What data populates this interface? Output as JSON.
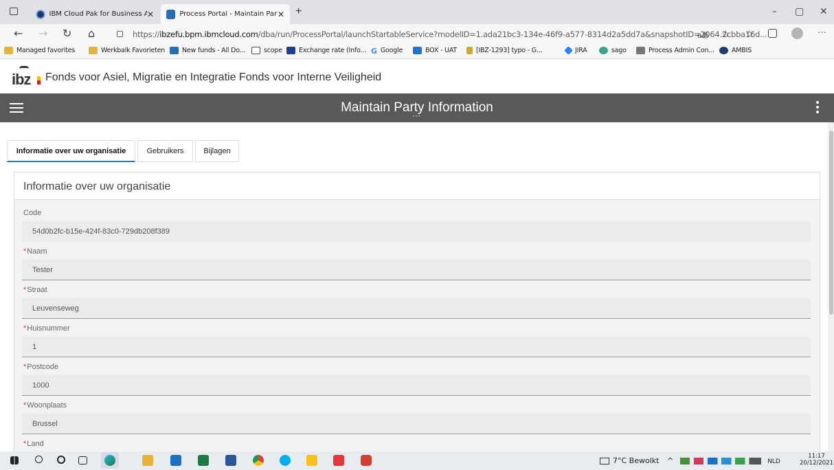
{
  "browser": {
    "tabs": [
      {
        "label": "IBM Cloud Pak for Business Auto",
        "active": false
      },
      {
        "label": "Process Portal - Maintain Party In",
        "active": true
      }
    ],
    "url_prefix": "https://",
    "url_host": "ibzefu.bpm.ibmcloud.com",
    "url_rest": "/dba/run/ProcessPortal/launchStartableService?modelID=1.ada21bc3-134e-46f9-a577-8314d2a5dd7a&snapshotID=2064.2cbba16d...",
    "favorites": [
      "Managed favorites",
      "Werkbalk Favorieten",
      "New funds - All Do...",
      "scope",
      "Exchange rate (Info...",
      "Google",
      "BOX - UAT",
      "[IBZ-1293] typo - G...",
      "JIRA",
      "sago",
      "Process Admin Con...",
      "AMBIS"
    ]
  },
  "header": {
    "logo_text": "ibz",
    "brand_title": "Fonds voor Asiel, Migratie en Integratie Fonds voor Interne Veiligheid",
    "page_title": "Maintain Party Information"
  },
  "page_tabs": [
    {
      "label": "Informatie over uw organisatie",
      "active": true
    },
    {
      "label": "Gebruikers",
      "active": false
    },
    {
      "label": "Bijlagen",
      "active": false
    }
  ],
  "panel": {
    "title": "Informatie over uw organisatie",
    "fields": [
      {
        "label": "Code",
        "required": false,
        "value": "54d0b2fc-b15e-424f-83c0-729db208f389"
      },
      {
        "label": "Naam",
        "required": true,
        "value": "Tester"
      },
      {
        "label": "Straat",
        "required": true,
        "value": "Leuvenseweg"
      },
      {
        "label": "Huisnummer",
        "required": true,
        "value": "1"
      },
      {
        "label": "Postcode",
        "required": true,
        "value": "1000"
      },
      {
        "label": "Woonplaats",
        "required": true,
        "value": "Brussel"
      },
      {
        "label": "Land",
        "required": true,
        "value": ""
      }
    ]
  },
  "taskbar": {
    "weather": "7°C Bewolkt",
    "language": "NLD",
    "time": "11:17",
    "date": "20/12/2021"
  },
  "colors": {
    "topbar": "#58595b",
    "accent": "#1f7ac9",
    "required": "#dd3333"
  }
}
